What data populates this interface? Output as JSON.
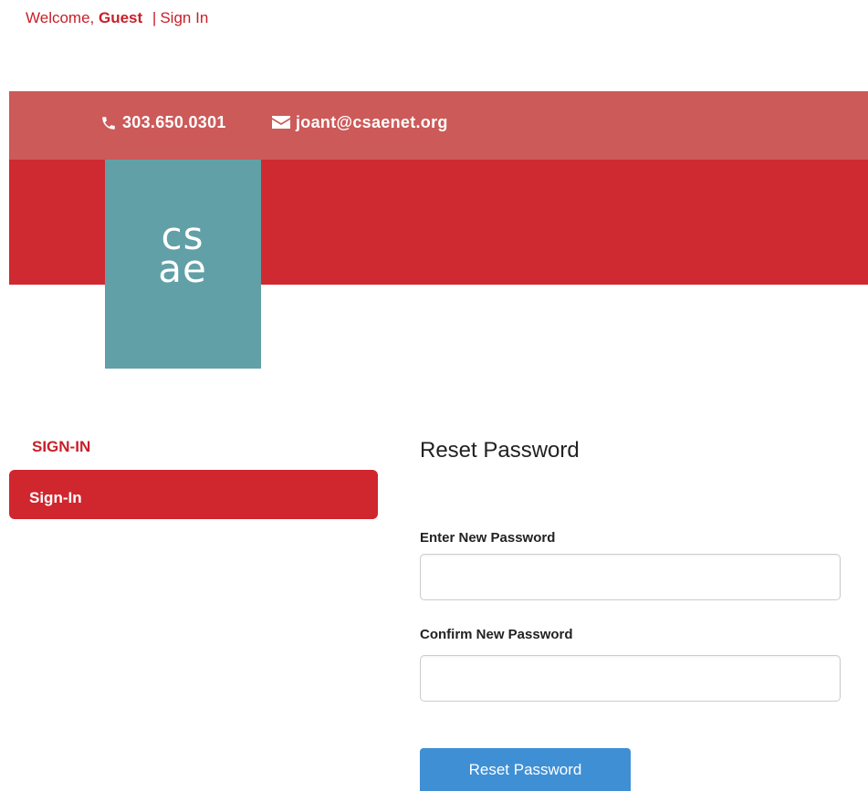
{
  "header": {
    "welcome_prefix": "Welcome,",
    "user_name": "Guest",
    "separator": "|",
    "signin_link": "Sign In"
  },
  "contact": {
    "phone": "303.650.0301",
    "email": "joant@csaenet.org"
  },
  "logo": {
    "line1": "cs",
    "line2": "ae"
  },
  "sidebar": {
    "heading": "SIGN-IN",
    "items": [
      {
        "label": "Sign-In"
      }
    ]
  },
  "form": {
    "title": "Reset Password",
    "new_password_label": "Enter New Password",
    "new_password_value": "",
    "confirm_password_label": "Confirm New Password",
    "confirm_password_value": "",
    "submit_label": "Reset Password"
  },
  "colors": {
    "brand_red": "#cf2a31",
    "contact_bar": "#cc5a58",
    "logo_teal": "#62a0a8",
    "button_blue": "#3f8fd4"
  },
  "icons": {
    "phone": "phone-icon",
    "email": "envelope-icon"
  }
}
